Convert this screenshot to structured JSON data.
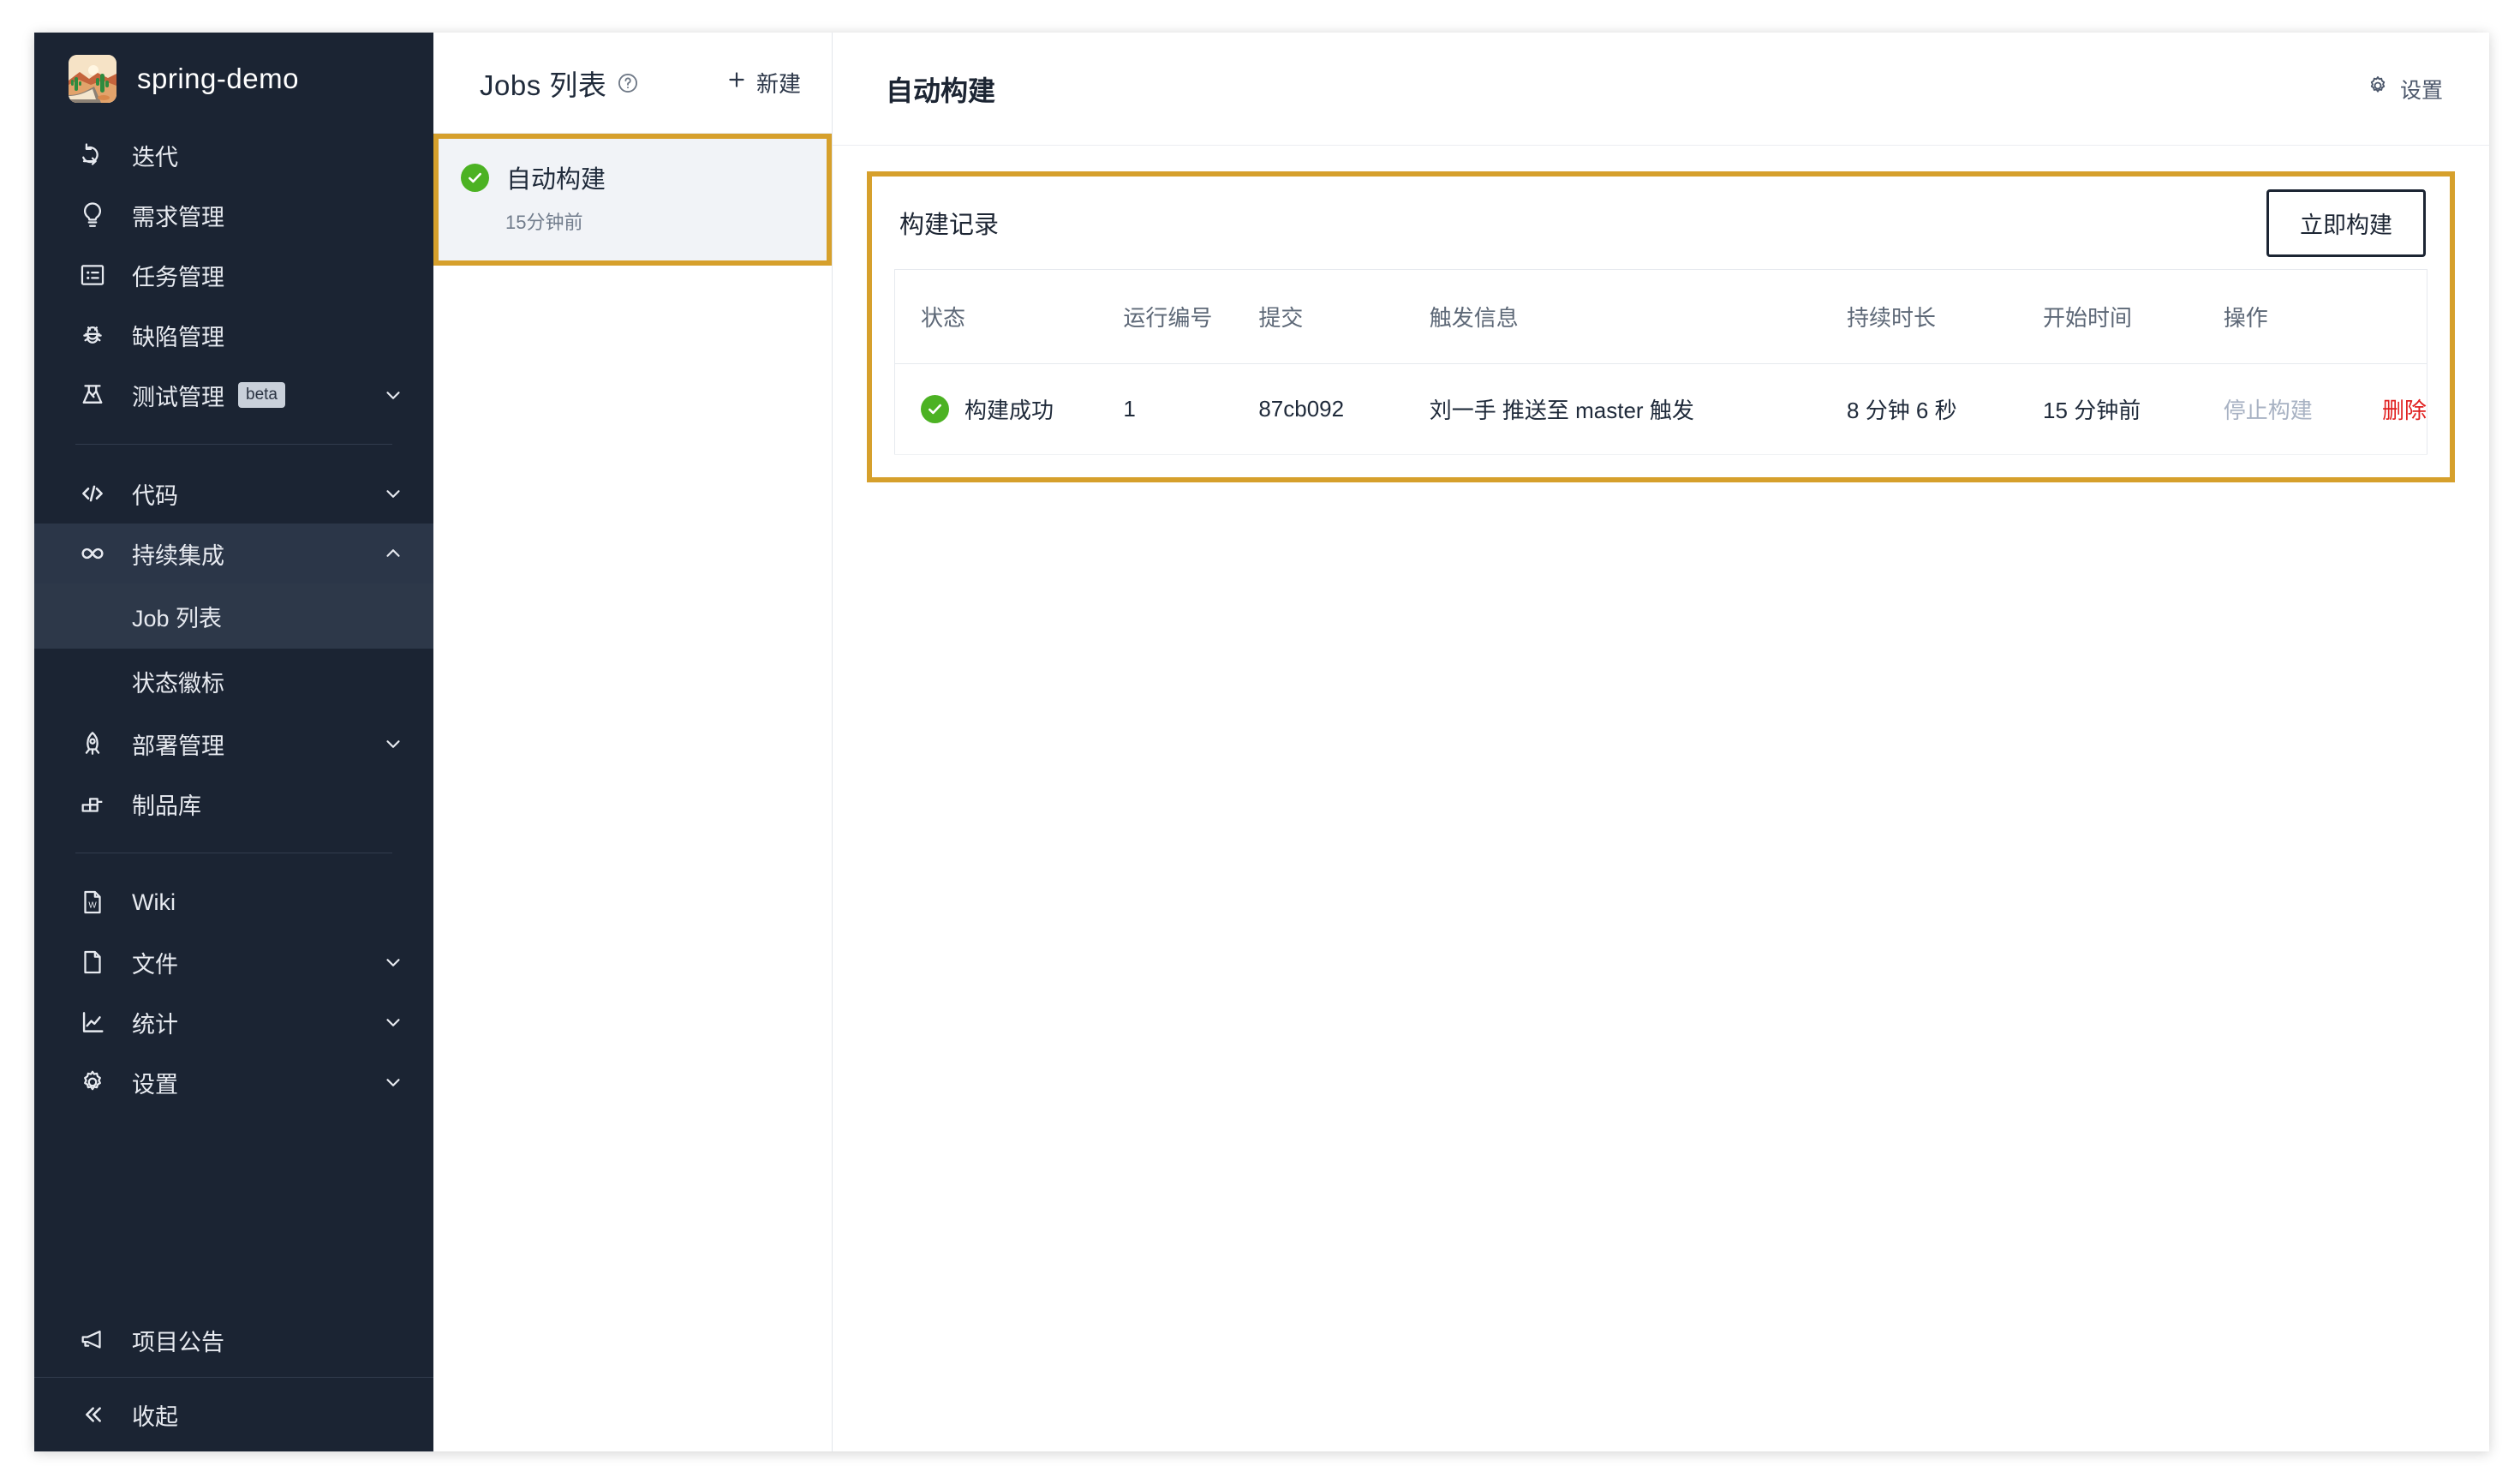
{
  "sidebar": {
    "project": {
      "name": "spring-demo",
      "logo": "desert-cactus-avatar"
    },
    "items": [
      {
        "label": "迭代",
        "icon": "iteration-icon",
        "chevron": ""
      },
      {
        "label": "需求管理",
        "icon": "lightbulb-icon",
        "chevron": ""
      },
      {
        "label": "任务管理",
        "icon": "task-list-icon",
        "chevron": ""
      },
      {
        "label": "缺陷管理",
        "icon": "bug-icon",
        "chevron": ""
      },
      {
        "label": "测试管理",
        "icon": "flask-icon",
        "badge": "beta",
        "chevron": "chevron-down"
      },
      {
        "label": "代码",
        "icon": "code-icon",
        "chevron": "chevron-down"
      },
      {
        "label": "持续集成",
        "icon": "infinity-icon",
        "chevron": "chevron-up",
        "active": true
      },
      {
        "label": "部署管理",
        "icon": "rocket-icon",
        "chevron": "chevron-down"
      },
      {
        "label": "制品库",
        "icon": "artifact-icon",
        "chevron": ""
      },
      {
        "label": "Wiki",
        "icon": "wiki-doc-icon",
        "chevron": ""
      },
      {
        "label": "文件",
        "icon": "file-icon",
        "chevron": "chevron-down"
      },
      {
        "label": "统计",
        "icon": "chart-icon",
        "chevron": "chevron-down"
      },
      {
        "label": "设置",
        "icon": "gear-icon",
        "chevron": "chevron-down"
      }
    ],
    "sub_items": [
      {
        "label": "Job 列表",
        "active": true
      },
      {
        "label": "状态徽标",
        "active": false
      }
    ],
    "announcement": {
      "label": "项目公告",
      "icon": "megaphone-icon"
    },
    "collapse": {
      "label": "收起",
      "icon": "double-chevron-left-icon"
    }
  },
  "jobs_panel": {
    "title": "Jobs 列表",
    "help_icon": "question-circle-icon",
    "new_button": "新建",
    "new_icon": "plus-icon",
    "job": {
      "name": "自动构建",
      "time": "15分钟前",
      "status_icon": "check-circle-icon",
      "status_color": "#4CB223",
      "highlight_color": "#D6A02C"
    }
  },
  "main": {
    "title": "自动构建",
    "settings_label": "设置",
    "settings_icon": "gear-icon",
    "panel": {
      "title": "构建记录",
      "build_now": "立即构建",
      "highlight_color": "#D6A02C"
    },
    "table": {
      "headers": [
        "状态",
        "运行编号",
        "提交",
        "触发信息",
        "持续时长",
        "开始时间",
        "操作"
      ],
      "rows": [
        {
          "status": "构建成功",
          "status_icon": "check-circle-icon",
          "run_number": "1",
          "commit": "87cb092",
          "trigger": "刘一手 推送至 master 触发",
          "duration": "8 分钟 6 秒",
          "start_time": "15 分钟前",
          "op_stop": "停止构建",
          "op_delete": "删除"
        }
      ]
    }
  },
  "colors": {
    "sidebar_bg": "#1B2433",
    "accent_highlight": "#D6A02C",
    "success_green": "#4CB223",
    "danger_red": "#E02020",
    "disabled_gray": "#A8B2C3"
  }
}
